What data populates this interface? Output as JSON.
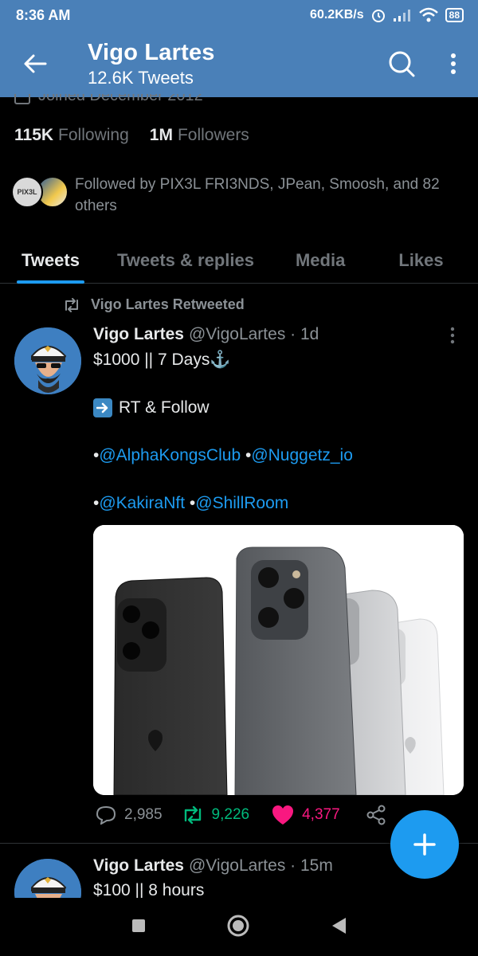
{
  "status_bar": {
    "time": "8:36 AM",
    "network_speed": "60.2KB/s",
    "battery": "88"
  },
  "header": {
    "name": "Vigo Lartes",
    "tweet_count": "12.6K Tweets"
  },
  "profile": {
    "joined": "Joined December 2012",
    "following_count": "115K",
    "following_label": "Following",
    "followers_count": "1M",
    "followers_label": "Followers",
    "followed_by": "Followed by PIX3L FRI3NDS, JPean, Smoosh, and 82 others",
    "followed_by_avatar_text": "PIX3L"
  },
  "tabs": [
    {
      "label": "Tweets",
      "active": true
    },
    {
      "label": "Tweets & replies",
      "active": false
    },
    {
      "label": "Media",
      "active": false
    },
    {
      "label": "Likes",
      "active": false
    }
  ],
  "tweets": [
    {
      "retweet_label": "Vigo Lartes Retweeted",
      "author": "Vigo Lartes",
      "meta": "@VigoLartes · 1d",
      "line1": "$1000 || 7 Days",
      "line1_emoji": "⚓",
      "line2_emoji": "➡️",
      "line2": "RT & Follow",
      "mentions_row1": [
        "@AlphaKongsClub",
        "@Nuggetz_io"
      ],
      "mentions_row2": [
        "@KakiraNft",
        "@ShillRoom"
      ],
      "replies": "2,985",
      "retweets": "9,226",
      "likes": "4,377"
    },
    {
      "author": "Vigo Lartes",
      "meta": "@VigoLartes · 15m",
      "line1": "$100 || 8 hours"
    }
  ],
  "colors": {
    "header_bg": "#4a80b8",
    "accent": "#1d9bf0",
    "retweet": "#00ba7c",
    "like": "#f91880"
  }
}
